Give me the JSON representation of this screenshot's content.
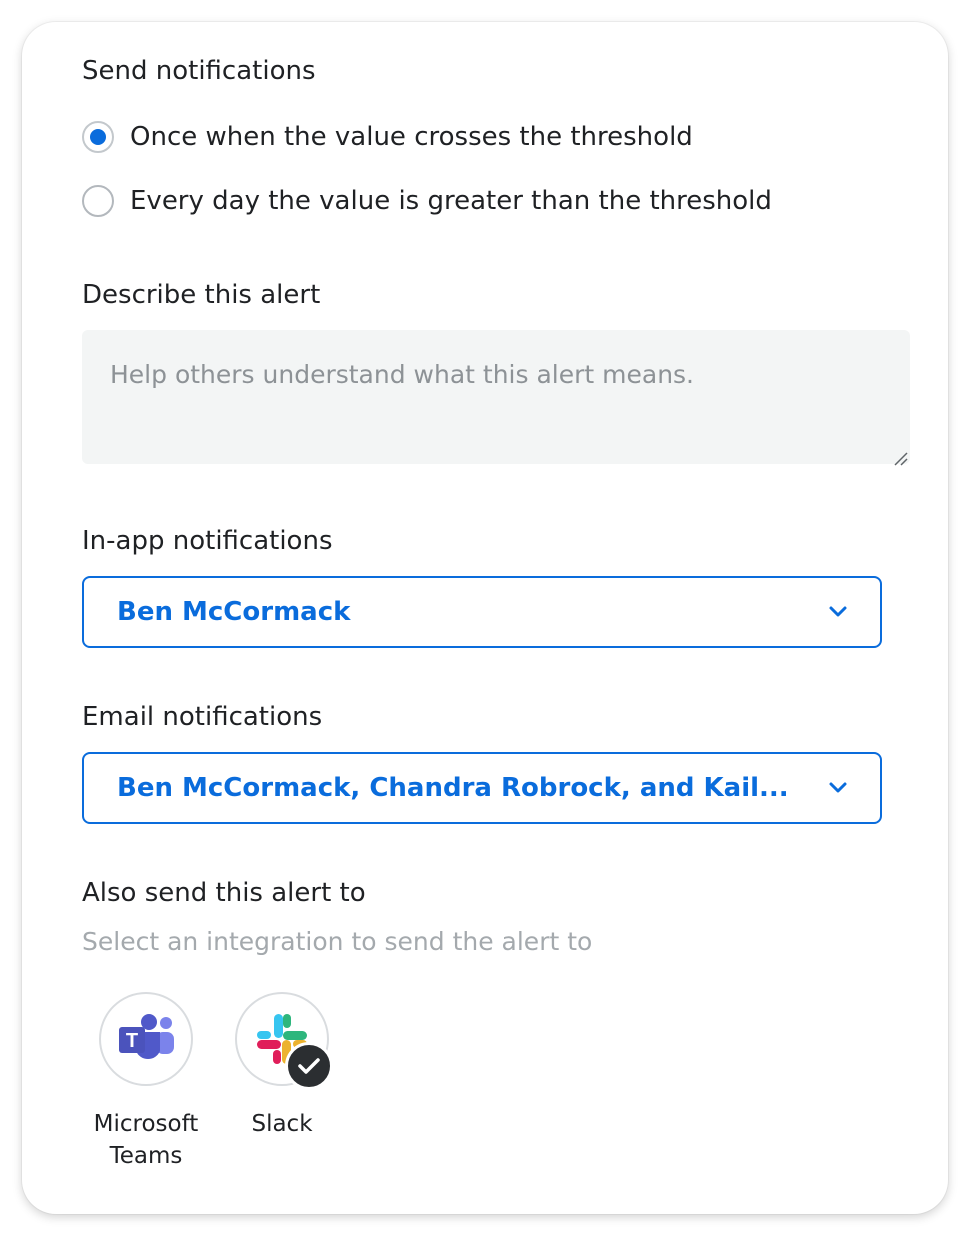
{
  "send": {
    "title": "Send notifications",
    "options": [
      {
        "label": "Once when the value crosses the threshold",
        "checked": true
      },
      {
        "label": "Every day the value is greater than the threshold",
        "checked": false
      }
    ]
  },
  "describe": {
    "title": "Describe this alert",
    "placeholder": "Help others understand what this alert means.",
    "value": ""
  },
  "inapp": {
    "title": "In-app notifications",
    "value": "Ben McCormack"
  },
  "email": {
    "title": "Email notifications",
    "value": "Ben McCormack, Chandra Robrock, and Kail..."
  },
  "also": {
    "title": "Also send this alert to",
    "hint": "Select an integration to send the alert to",
    "integrations": [
      {
        "name_line1": "Microsoft",
        "name_line2": "Teams",
        "icon": "microsoft-teams-icon",
        "selected": false
      },
      {
        "name_line1": "Slack",
        "name_line2": "",
        "icon": "slack-icon",
        "selected": true
      }
    ]
  },
  "colors": {
    "accent": "#0a6cdc",
    "muted_text": "#a4a9ad",
    "input_bg": "#f3f5f5",
    "badge": "#2b2e31"
  }
}
